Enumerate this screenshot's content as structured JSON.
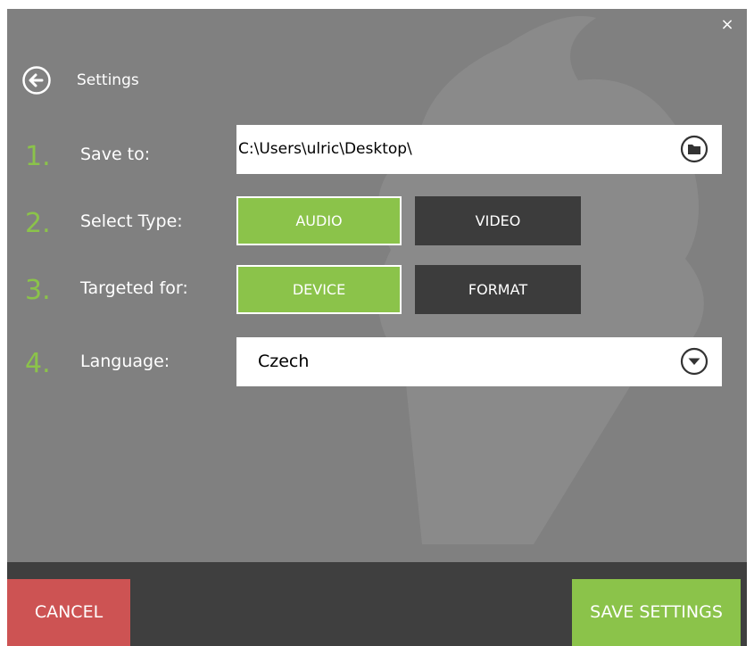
{
  "window": {
    "close_glyph": "×",
    "title": "Settings"
  },
  "steps": [
    {
      "number": "1.",
      "label": "Save to:"
    },
    {
      "number": "2.",
      "label": "Select Type:"
    },
    {
      "number": "3.",
      "label": "Targeted for:"
    },
    {
      "number": "4.",
      "label": "Language:"
    }
  ],
  "save_to": {
    "path": "C:\\Users\\ulric\\Desktop\\",
    "icon": "folder-icon"
  },
  "select_type": {
    "options": [
      {
        "label": "AUDIO",
        "selected": true
      },
      {
        "label": "VIDEO",
        "selected": false
      }
    ]
  },
  "targeted_for": {
    "options": [
      {
        "label": "DEVICE",
        "selected": true
      },
      {
        "label": "FORMAT",
        "selected": false
      }
    ]
  },
  "language": {
    "selected": "Czech",
    "icon": "chevron-down-icon"
  },
  "footer": {
    "cancel_label": "CANCEL",
    "save_label": "SAVE SETTINGS"
  },
  "colors": {
    "accent_green": "#8bc34a",
    "cancel_red": "#cd5353",
    "panel_gray": "#808080",
    "footer_dark": "#3f3f3f",
    "unselected_dark": "#3c3c3c"
  },
  "icons": [
    "close-icon",
    "back-arrow-icon",
    "folder-icon",
    "chevron-down-icon"
  ]
}
